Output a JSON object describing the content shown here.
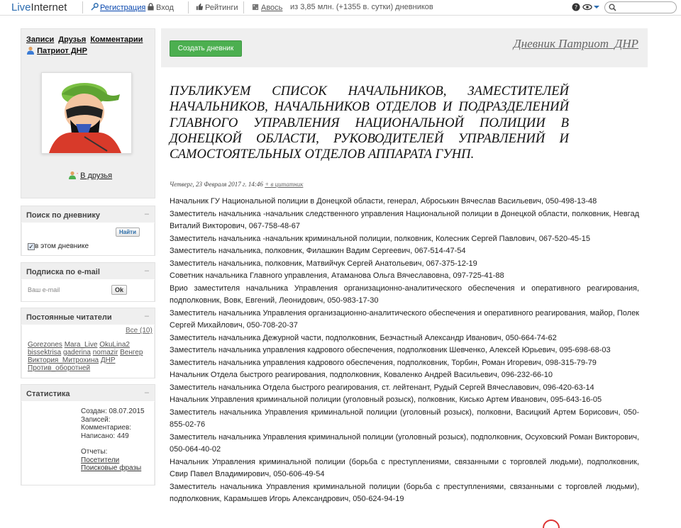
{
  "topbar": {
    "logo_part1": "Live",
    "logo_part2": "Internet",
    "register": "Регистрация",
    "login": "Вход",
    "ratings": "Рейтинги",
    "avos": "Авось",
    "stats": "из 3,85 млн. (+1355 в. сутки) дневников",
    "search_placeholder": ""
  },
  "sidebar": {
    "nav": [
      "Записи",
      "Друзья",
      "Комментарии"
    ],
    "username": "Патриот ДНР",
    "add_friend": "В друзья",
    "search": {
      "title": "Поиск по дневнику",
      "button": "Найти",
      "checkbox_label": "в этом дневнике"
    },
    "subscribe": {
      "title": "Подписка по e-mail",
      "placeholder": "Ваш e-mail",
      "button": "Ok"
    },
    "readers": {
      "title": "Постоянные читатели",
      "all": "Все (10)",
      "names": [
        "Gorezones",
        "Mara_Live",
        "OkuLina2",
        "bissektrisa",
        "gaderina",
        "nomazir",
        "Венгер",
        "Виктория_Митрохина",
        "ДНР",
        "Против_оборотней"
      ]
    },
    "stats": {
      "title": "Статистика",
      "created": "Создан: 08.07.2015",
      "posts": "Записей:",
      "comments": "Комментариев:",
      "written": "Написано: 449",
      "reports": "Отчеты:",
      "visitors": "Посетители",
      "queries": "Поисковые фразы"
    }
  },
  "main": {
    "create_button": "Создать дневник",
    "diary_title": "Дневник Патриот_ДНР",
    "post_title": "ПУБЛИКУЕМ СПИСОК НАЧАЛЬНИКОВ, ЗАМЕСТИТЕЛЕЙ НАЧАЛЬНИКОВ, НАЧАЛЬНИКОВ ОТДЕЛОВ И ПОДРАЗДЕЛЕНИЙ ГЛАВНОГО УПРАВЛЕНИЯ НАЦИОНАЛЬНОЙ ПОЛИЦИИ В ДОНЕЦКОЙ ОБЛАСТИ, РУКОВОДИТЕЛЕЙ УПРАВЛЕНИЙ И САМОСТОЯТЕЛЬНЫХ ОТДЕЛОВ АППАРАТА ГУНП.",
    "post_date": "Четверг, 23 Февраля 2017 г. 14:46",
    "quote_link": "+ в цитатник",
    "paragraphs": [
      "Начальник ГУ Национальной полиции в Донецкой области, генерал, Аброськин Вячеслав Васильевич, 050-498-13-48",
      "Заместитель начальника -начальник следственного управления Национальной полиции в Донецкой области, полковник, Невгад Виталий Викторович, 067-758-48-67",
      "Заместитель начальника -начальник криминальной полиции, полковник, Колесник Сергей Павлович, 067-520-45-15",
      "Заместитель начальника, полковник, Филашкин Вадим Сергеевич, 067-514-47-54",
      "Заместитель начальника, полковник, Матвийчук Сергей Анатольевич, 067-375-12-19",
      "Советник начальника Главного управления, Атаманова Ольга Вячеславовна, 097-725-41-88",
      "Врио заместителя начальника Управления организационно-аналитического обеспечения и оперативного реагирования, подполковник, Вовк, Евгений, Леонидович, 050-983-17-30",
      "Заместитель начальника Управления организационно-аналитического обеспечения и оперативного реагирования, майор, Полек Сергей Михайлович, 050-708-20-37",
      "Заместитель начальника Дежурной части, подполковник, Безчастный Александр Иванович, 050-664-74-62",
      "Заместитель начальника управления кадрового обеспечения, подполковник Шевченко, Алексей Юрьевич, 095-698-68-03",
      "Заместитель начальника управления кадрового обеспечения, подполковник, Торбин, Роман Игоревич, 098-315-79-79",
      "Начальник Отдела быстрого реагирования, подполковник, Коваленко Андрей Васильевич, 096-232-66-10",
      "Заместитель начальника Отдела быстрого реагирования, ст. лейтенант, Рудый Сергей Вячеславович, 096-420-63-14",
      "Начальник Управления криминальной полиции (уголовный розыск), полковник, Кисько Артем Иванович, 095-643-16-05",
      "Заместитель начальника Управления криминальной полиции (уголовный розыск), полковни, Васицкий Артем Борисович, 050-855-02-76",
      "Заместитель начальника Управления криминальной полиции (уголовный розыск), подполковник, Осуховский Роман Викторович, 050-064-40-02",
      "Начальник Управления криминальной полиции (борьба с преступлениями, связанными с торговлей людьми), подполковник, Свир Павел Владимирович, 050-606-49-54",
      "Заместитель начальника Управления криминальной полиции (борьба с преступлениями, связанными с торговлей людьми), подполковник, Карамышев Игорь Александрович, 050-624-94-19"
    ]
  },
  "colors": {
    "link": "#0645ad",
    "green_button": "#4caf50",
    "panel_bg": "#efefef"
  }
}
